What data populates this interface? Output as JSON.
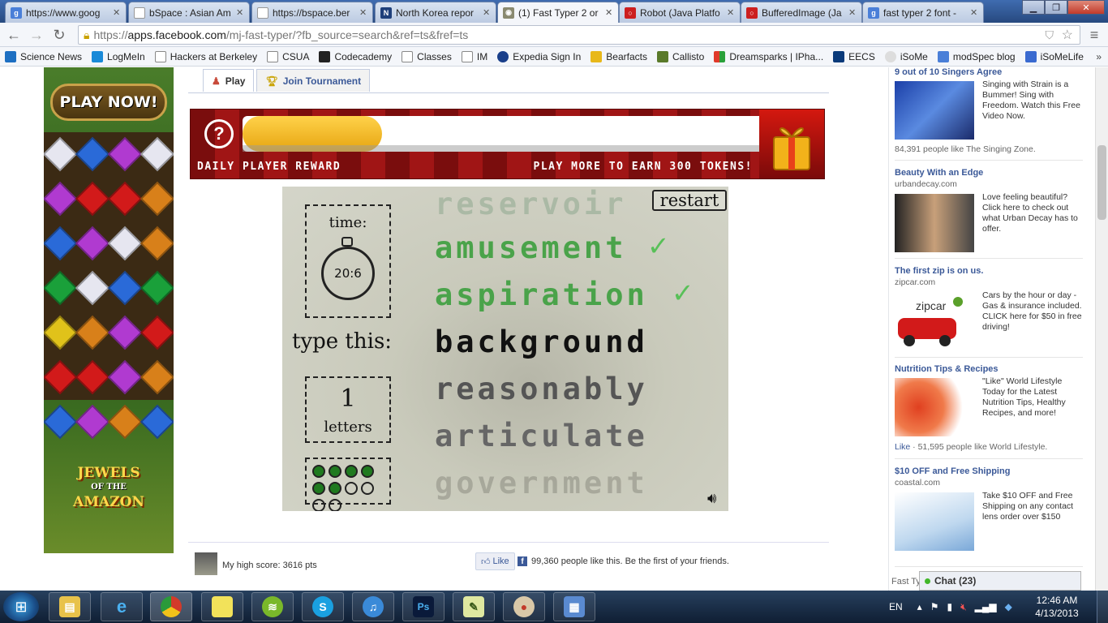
{
  "browser": {
    "tabs": [
      {
        "title": "https://www.goog",
        "fav": "g-icon",
        "color": "#4a7fd8"
      },
      {
        "title": "bSpace : Asian Am",
        "fav": "doc-icon",
        "color": "#ffffff"
      },
      {
        "title": "https://bspace.ber",
        "fav": "doc-icon",
        "color": "#ffffff"
      },
      {
        "title": "North Korea repor",
        "fav": "news-icon",
        "color": "#1e3f7a"
      },
      {
        "title": "(1) Fast Typer 2 or",
        "fav": "game-icon",
        "color": "#8a8a70"
      },
      {
        "title": "Robot (Java Platfo",
        "fav": "oracle-icon",
        "color": "#cc1f1f"
      },
      {
        "title": "BufferedImage (Ja",
        "fav": "oracle-icon",
        "color": "#cc1f1f"
      },
      {
        "title": "fast typer 2 font -",
        "fav": "g-icon",
        "color": "#4a7fd8"
      }
    ],
    "url_scheme": "https://",
    "url_host": "apps.facebook.com",
    "url_path": "/mj-fast-typer/?fb_source=search&ref=ts&fref=ts",
    "bookmarks": [
      {
        "label": "Science News",
        "color": "#1d6fc2"
      },
      {
        "label": "LogMeIn",
        "color": "#1a8ad8"
      },
      {
        "label": "Hackers at Berkeley",
        "color": "#ffffff"
      },
      {
        "label": "CSUA",
        "color": "#ffffff"
      },
      {
        "label": "Codecademy",
        "color": "#222222"
      },
      {
        "label": "Classes",
        "color": "#ffffff"
      },
      {
        "label": "IM",
        "color": "#ffffff"
      },
      {
        "label": "Expedia Sign In",
        "color": "#1a3f8a"
      },
      {
        "label": "Bearfacts",
        "color": "#e8b81a"
      },
      {
        "label": "Callisto",
        "color": "#5a7a2a"
      },
      {
        "label": "Dreamsparks | IPha...",
        "color": "#e03a2a"
      },
      {
        "label": "EECS",
        "color": "#0a3a7a"
      },
      {
        "label": "iSoMe",
        "color": "#dddddd"
      },
      {
        "label": "modSpec blog",
        "color": "#4a7fd8"
      },
      {
        "label": "iSoMeLife",
        "color": "#3a6ad0"
      }
    ]
  },
  "left_ad": {
    "cta": "PLAY NOW!",
    "logo_line1": "JEWELS",
    "logo_line2": "OF THE",
    "logo_line3": "AMAZON"
  },
  "app_tabs": {
    "play": "Play",
    "tournament": "Join Tournament"
  },
  "reward": {
    "help": "?",
    "progress": 0.27,
    "left_text": "DAILY PLAYER REWARD",
    "right_text": "PLAY MORE TO EARN 300 TOKENS!"
  },
  "game": {
    "restart": "restart",
    "time_label": "time:",
    "time_value": "20:6",
    "type_this": "type this:",
    "letters_count": "1",
    "letters_label": "letters",
    "words": {
      "prev_faded": "reservoir",
      "done1": "amusement",
      "done2": "aspiration",
      "current": "background",
      "next1": "reasonably",
      "next2": "articulate",
      "next3": "government"
    },
    "lives_total": 10,
    "lives_full": 6
  },
  "footer": {
    "high_score": "My high score: 3616 pts",
    "like_button": "Like",
    "likes_text": "99,360 people like this. Be the first of your friends."
  },
  "right_ads": [
    {
      "title": "9 out of 10 Singers Agree",
      "domain": "",
      "body": "Singing with Strain is a Bummer! Sing with Freedom. Watch this Free Video Now.",
      "social": "84,391 people like The Singing Zone."
    },
    {
      "title": "Beauty With an Edge",
      "domain": "urbandecay.com",
      "body": "Love feeling beautiful? Click here to check out what Urban Decay has to offer.",
      "social": ""
    },
    {
      "title": "The first zip is on us.",
      "domain": "zipcar.com",
      "body": "Cars by the hour or day - Gas & insurance included. CLICK here for $50 in free driving!",
      "social": ""
    },
    {
      "title": "Nutrition Tips & Recipes",
      "domain": "",
      "body": "\"Like\" World Lifestyle Today for the Latest Nutrition Tips, Healthy Recipes, and more!",
      "social_like": "Like",
      "social": " · 51,595 people like World Lifestyle."
    },
    {
      "title": "$10 OFF and Free Shipping",
      "domain": "coastal.com",
      "body": "Take $10 OFF and Free Shipping on any contact lens order over $150",
      "social": ""
    }
  ],
  "fast_typer_stub": "Fast Ty",
  "chat": "Chat (23)",
  "taskbar": {
    "lang": "EN",
    "time": "12:46 AM",
    "date": "4/13/2013",
    "apps": [
      "explorer",
      "ie",
      "chrome",
      "stickies",
      "spotify",
      "skype",
      "itunes",
      "photoshop",
      "notepad",
      "paint",
      "control"
    ]
  }
}
